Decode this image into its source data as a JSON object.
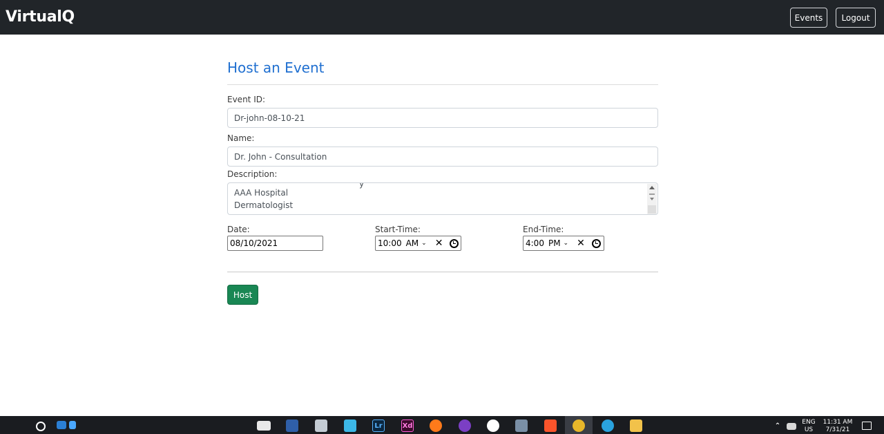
{
  "app": {
    "brand": "VirtualQ"
  },
  "nav": {
    "events_label": "Events",
    "logout_label": "Logout"
  },
  "form": {
    "title": "Host an Event",
    "event_id_label": "Event ID:",
    "event_id_value": "Dr-john-08-10-21",
    "name_label": "Name:",
    "name_value": "Dr. John - Consultation",
    "description_label": "Description:",
    "description_lines": [
      "AAA Hospital",
      "Dermatologist"
    ],
    "description_partial": "y",
    "date_label": "Date:",
    "date_value": "08/10/2021",
    "start_label": "Start-Time:",
    "start_time": "10:00",
    "start_ampm": "AM",
    "end_label": "End-Time:",
    "end_time": "4:00",
    "end_ampm": "PM",
    "host_label": "Host"
  },
  "taskbar": {
    "icons": [
      "windows-start",
      "search",
      "network-app",
      "media",
      "terminal",
      "folder-sync",
      "screen-connect",
      "lightroom",
      "xd",
      "firefox",
      "tor",
      "app-w",
      "virtualbox",
      "brave",
      "chrome",
      "telegram",
      "file-explorer"
    ],
    "icon_labels": {
      "lightroom": "Lr",
      "xd": "Xd"
    },
    "lang_top": "ENG",
    "lang_bottom": "US",
    "time": "11:31 AM",
    "date": "7/31/21"
  },
  "colors": {
    "navbar_bg": "#212529",
    "title_blue": "#1f6fd0",
    "host_green": "#198754",
    "taskbar_bg": "#1a1c20"
  }
}
